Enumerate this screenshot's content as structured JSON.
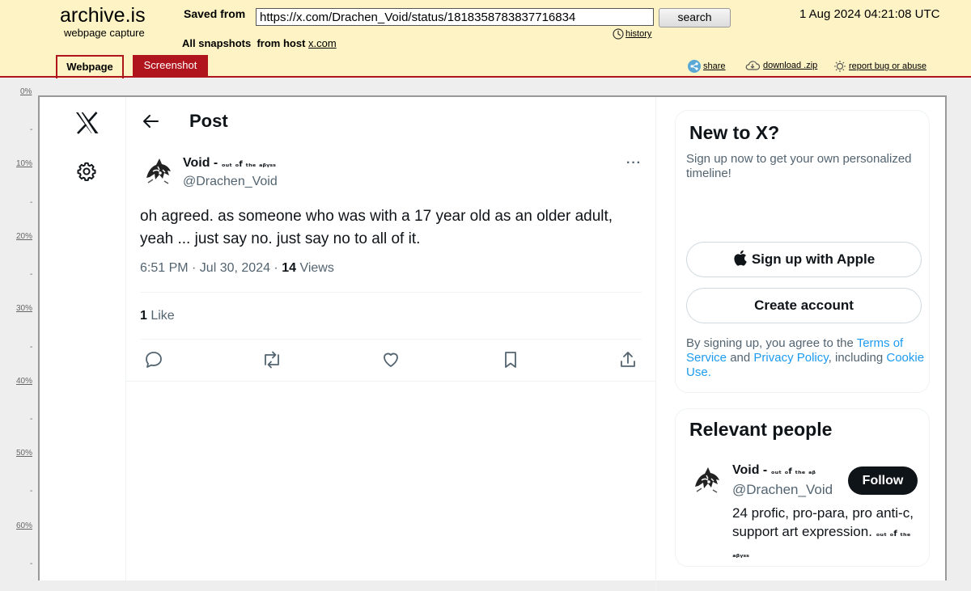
{
  "archive": {
    "logo": "archive.is",
    "logo_sub": "webpage capture",
    "saved_from_label": "Saved from",
    "url": "https://x.com/Drachen_Void/status/1818358783837716834",
    "search_label": "search",
    "capture_date": "1 Aug 2024 04:21:08 UTC",
    "history_label": "history",
    "all_snapshots_label": "All snapshots  from host",
    "host": "x.com",
    "tabs": [
      {
        "label": "Webpage",
        "active": true
      },
      {
        "label": "Screenshot",
        "active": false
      }
    ],
    "links": {
      "share": "share",
      "download": "download .zip",
      "report": "report bug or abuse"
    },
    "accent_color": "#b0141c",
    "header_bg": "#fdf3c4"
  },
  "ruler": {
    "labels": [
      "0%",
      "10%",
      "20%",
      "30%",
      "40%",
      "50%",
      "60%"
    ],
    "dash": "-"
  },
  "post": {
    "header_title": "Post",
    "author_name": "Void - ",
    "author_name_tail": "ₒᵤₜ ₒf ₜₕₑ ₐᵦᵧₛₛ",
    "author_handle": "@Drachen_Void",
    "more": "···",
    "text": "oh agreed. as someone who was with a 17 year old as an older adult, yeah ... just say no. just say no to all of it.",
    "time": "6:51 PM · Jul 30, 2024 · ",
    "views_count": "14",
    "views_label": " Views",
    "likes_count": "1",
    "likes_label": " Like",
    "actions": [
      "reply-icon",
      "repost-icon",
      "like-icon",
      "bookmark-icon",
      "share-icon"
    ]
  },
  "signup": {
    "title": "New to X?",
    "text": "Sign up now to get your own personalized timeline!",
    "apple_label": "Sign up with Apple",
    "create_label": "Create account",
    "terms_prefix": "By signing up, you agree to the ",
    "terms_link": "Terms of Service",
    "terms_and": " and ",
    "privacy_link": "Privacy Policy",
    "terms_including": ", including ",
    "cookie_link": "Cookie Use",
    "terms_end": "."
  },
  "relevant": {
    "title": "Relevant people",
    "name": "Void - ",
    "name_tail": "ₒᵤₜ ₒf ₜₕₑ ₐᵦ",
    "handle": "@Drachen_Void",
    "follow_label": "Follow",
    "bio": "24 profic, pro-para, pro anti-c, support art expression. ",
    "bio_tail": "ₒᵤₜ ₒf ₜₕₑ ₐᵦᵧₛₛ"
  }
}
